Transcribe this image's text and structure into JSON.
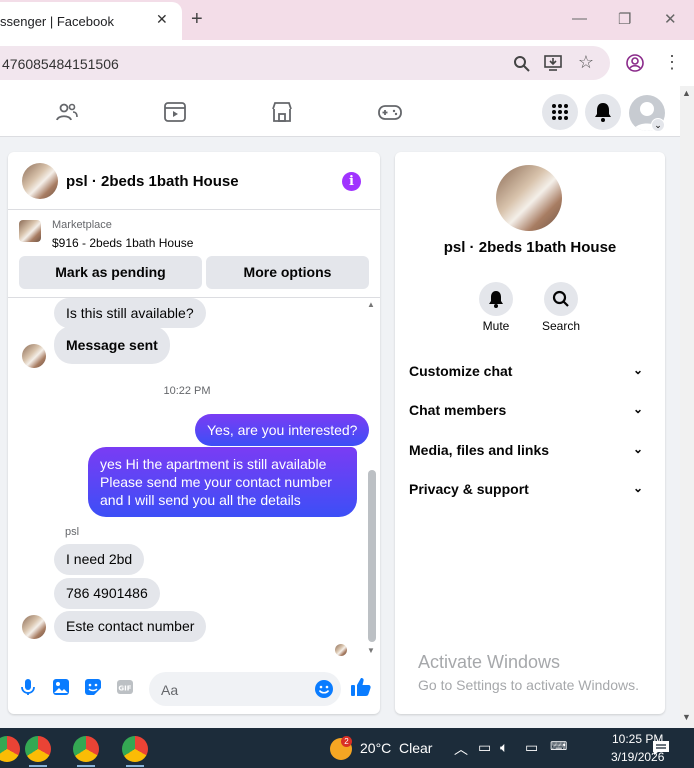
{
  "browser": {
    "tab_title": "ssenger | Facebook",
    "url": "476085484151506"
  },
  "chat": {
    "title": "psl · 2beds 1bath House",
    "marketplace_label": "Marketplace",
    "listing": "$916 - 2beds 1bath House",
    "mark_pending_label": "Mark as pending",
    "more_options_label": "More options",
    "messages": {
      "m1": "Is this still available?",
      "m2": "Message sent",
      "timestamp": "10:22 PM",
      "m3": "Yes, are you interested?",
      "m4_line1": "yes Hi the apartment is still available",
      "m4_line2": "Please send me your contact number",
      "m4_line3": "and I will send you all the details",
      "sender": "psl",
      "m5": "I need 2bd",
      "m6": "786 4901486",
      "m7": "Este contact number"
    },
    "composer_placeholder": "Aa"
  },
  "info": {
    "title": "psl · 2beds 1bath House",
    "mute_label": "Mute",
    "search_label": "Search",
    "rows": [
      "Customize chat",
      "Chat members",
      "Media, files and links",
      "Privacy & support"
    ]
  },
  "watermark": {
    "line1": "Activate Windows",
    "line2": "Go to Settings to activate Windows."
  },
  "taskbar": {
    "weather_badge": "2",
    "temperature": "20°C",
    "condition": "Clear",
    "time": "10:25 PM",
    "date": "3/19/2026"
  },
  "colors": {
    "accent": "#a033ff",
    "outgoing_top": "#7a3cf4",
    "outgoing_bottom": "#3c4ff6",
    "messenger_blue": "#0a7cff"
  }
}
